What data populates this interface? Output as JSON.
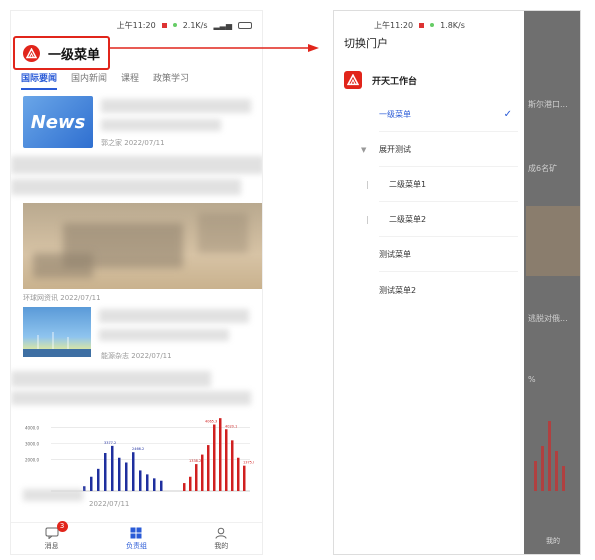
{
  "left": {
    "status_time": "上午11:20",
    "status_speed": "2.1K/s",
    "portal_title": "一级菜单",
    "tabs": [
      "国际要闻",
      "国内新闻",
      "课程",
      "政策学习"
    ],
    "news_image_label": "News",
    "articles": [
      {
        "source": "郭之家",
        "date": "2022/07/11"
      },
      {
        "source": "环球网资讯",
        "date": "2022/07/11"
      },
      {
        "source": "能源杂志",
        "date": "2022/07/11"
      },
      {
        "source": "",
        "date": "2022/07/11"
      }
    ],
    "nav": [
      {
        "label": "消息",
        "badge": "3"
      },
      {
        "label": "负责组"
      },
      {
        "label": "我的"
      }
    ]
  },
  "right": {
    "status_time": "上午11:20",
    "status_speed": "1.8K/s",
    "drawer_title": "切换门户",
    "workbench": "开天工作台",
    "menu": [
      {
        "label": "一级菜单",
        "selected": true
      },
      {
        "label": "展开测试",
        "expandable": true
      },
      {
        "label": "二级菜单1",
        "child": true
      },
      {
        "label": "二级菜单2",
        "child": true
      },
      {
        "label": "测试菜单"
      },
      {
        "label": "测试菜单2"
      }
    ],
    "background_snippets": [
      "斯尔港口...",
      "成6名矿",
      "逃脱对俄...",
      "%",
      "我的"
    ]
  },
  "colors": {
    "accent": "#2a5bd7",
    "brand": "#e1251b"
  },
  "chart_data": {
    "type": "bar",
    "y_tick_labels": [
      "4000.0",
      "3000.0",
      "2000.0"
    ],
    "series": [
      {
        "color": "#1f2f9e",
        "values": [
          300,
          900,
          1400,
          2400,
          2850,
          2100,
          1800,
          2450,
          1300,
          1050,
          800,
          650
        ]
      },
      {
        "color": "#d02020",
        "values": [
          500,
          900,
          1700,
          2300,
          2900,
          4200,
          4600,
          3900,
          3200,
          2100,
          1600
        ]
      }
    ],
    "data_labels": [
      "3377.2",
      "2466.2",
      "4065.3",
      "1338.2",
      "4020.1",
      "1375.0"
    ],
    "ylim": [
      0,
      4800
    ]
  }
}
